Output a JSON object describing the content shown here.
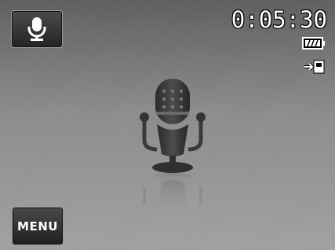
{
  "mode": {
    "icon": "microphone-icon"
  },
  "status": {
    "recording_time": "0:05:30",
    "battery_icon": "battery-full-icon",
    "storage_icon": "internal-memory-icon"
  },
  "center": {
    "icon": "microphone-icon"
  },
  "menu": {
    "label": "MENU"
  }
}
